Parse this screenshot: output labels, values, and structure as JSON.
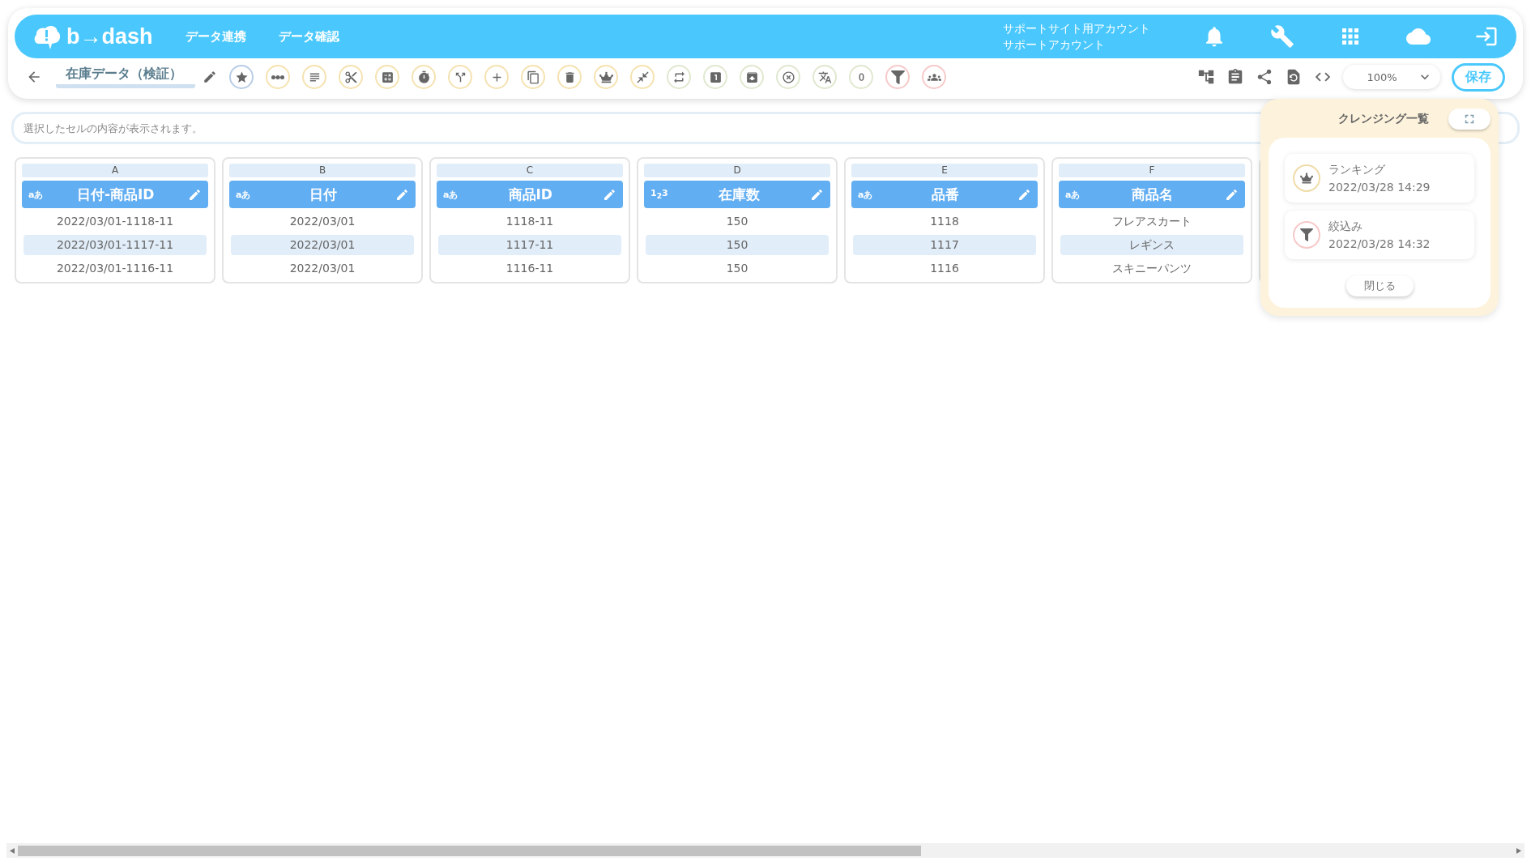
{
  "header": {
    "logo": "b→dash",
    "nav": [
      "データ連携",
      "データ確認"
    ],
    "account": {
      "site": "サポートサイト用アカウント",
      "user": "サポートアカウント"
    }
  },
  "toolbar": {
    "title": "在庫データ（検証）",
    "tools": [
      {
        "color": "#b8cde6"
      },
      {
        "color": "#f5e2b0"
      },
      {
        "color": "#f5e2b0"
      },
      {
        "color": "#f5e2b0"
      },
      {
        "color": "#f5e2b0"
      },
      {
        "color": "#f5e2b0"
      },
      {
        "color": "#f5e2b0"
      },
      {
        "color": "#f5e2b0"
      },
      {
        "color": "#f5e2b0"
      },
      {
        "color": "#f5e2b0"
      },
      {
        "color": "#f5e2b0"
      },
      {
        "color": "#f5e2b0"
      },
      {
        "color": "#dfe8cf"
      },
      {
        "color": "#dfe8cf"
      },
      {
        "color": "#dfe8cf"
      },
      {
        "color": "#dfe8cf"
      },
      {
        "color": "#dfe8cf"
      },
      {
        "color": "#dfe8cf"
      },
      {
        "color": "#f7c9c9"
      },
      {
        "color": "#f7c9c9"
      }
    ],
    "zoom": "100%",
    "save": "保存"
  },
  "cell_view": {
    "placeholder": "選択したセルの内容が表示されます。"
  },
  "columns": [
    {
      "letter": "A",
      "type": "aあ",
      "name": "日付-商品ID",
      "cells": [
        "2022/03/01-1118-11",
        "2022/03/01-1117-11",
        "2022/03/01-1116-11"
      ]
    },
    {
      "letter": "B",
      "type": "aあ",
      "name": "日付",
      "cells": [
        "2022/03/01",
        "2022/03/01",
        "2022/03/01"
      ]
    },
    {
      "letter": "C",
      "type": "aあ",
      "name": "商品ID",
      "cells": [
        "1118-11",
        "1117-11",
        "1116-11"
      ]
    },
    {
      "letter": "D",
      "type": "1$_{2}$3",
      "name": "在庫数",
      "cells": [
        "150",
        "150",
        "150"
      ]
    },
    {
      "letter": "E",
      "type": "aあ",
      "name": "品番",
      "cells": [
        "1118",
        "1117",
        "1116"
      ]
    },
    {
      "letter": "F",
      "type": "aあ",
      "name": "商品名",
      "cells": [
        "フレアスカート",
        "レギンス",
        "スキニーパンツ"
      ]
    }
  ],
  "cleansing_panel": {
    "title": "クレンジング一覧",
    "items": [
      {
        "kind": "ranking",
        "color": "#f0dca8",
        "name": "ランキング",
        "time": "2022/03/28 14:29"
      },
      {
        "kind": "filter",
        "color": "#f7c9c9",
        "name": "絞込み",
        "time": "2022/03/28 14:32"
      }
    ],
    "close": "閉じる"
  }
}
